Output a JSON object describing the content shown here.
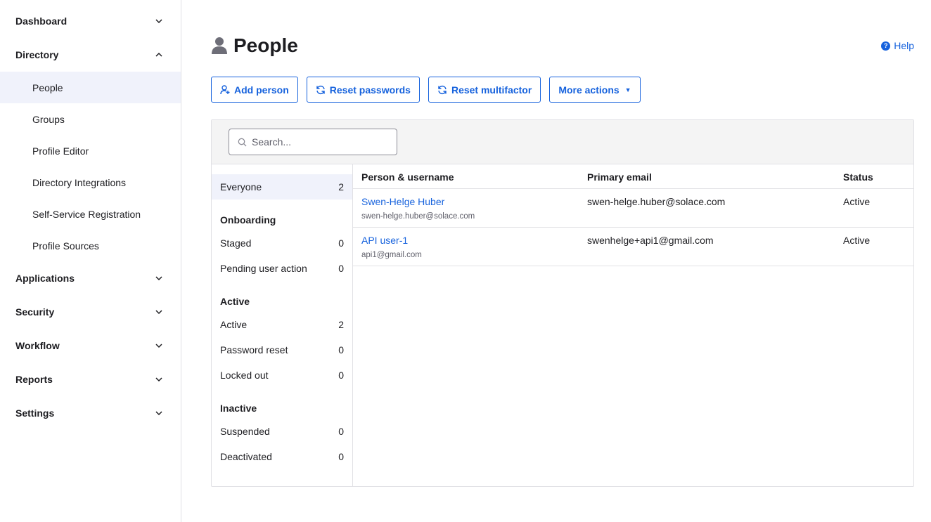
{
  "sidebar": {
    "groups": [
      {
        "label": "Dashboard",
        "expanded": false
      },
      {
        "label": "Directory",
        "expanded": true
      },
      {
        "label": "Applications",
        "expanded": false
      },
      {
        "label": "Security",
        "expanded": false
      },
      {
        "label": "Workflow",
        "expanded": false
      },
      {
        "label": "Reports",
        "expanded": false
      },
      {
        "label": "Settings",
        "expanded": false
      }
    ],
    "directory_items": [
      {
        "label": "People",
        "active": true
      },
      {
        "label": "Groups"
      },
      {
        "label": "Profile Editor"
      },
      {
        "label": "Directory Integrations"
      },
      {
        "label": "Self-Service Registration"
      },
      {
        "label": "Profile Sources"
      }
    ]
  },
  "header": {
    "title": "People",
    "help_label": "Help"
  },
  "toolbar": {
    "add_person": "Add person",
    "reset_passwords": "Reset passwords",
    "reset_multifactor": "Reset multifactor",
    "more_actions": "More actions"
  },
  "search": {
    "placeholder": "Search..."
  },
  "filters": {
    "everyone": {
      "label": "Everyone",
      "count": "2"
    },
    "sections": [
      {
        "heading": "Onboarding",
        "items": [
          {
            "label": "Staged",
            "count": "0"
          },
          {
            "label": "Pending user action",
            "count": "0"
          }
        ]
      },
      {
        "heading": "Active",
        "items": [
          {
            "label": "Active",
            "count": "2"
          },
          {
            "label": "Password reset",
            "count": "0"
          },
          {
            "label": "Locked out",
            "count": "0"
          }
        ]
      },
      {
        "heading": "Inactive",
        "items": [
          {
            "label": "Suspended",
            "count": "0"
          },
          {
            "label": "Deactivated",
            "count": "0"
          }
        ]
      }
    ]
  },
  "table": {
    "columns": [
      "Person & username",
      "Primary email",
      "Status"
    ],
    "rows": [
      {
        "name": "Swen-Helge Huber",
        "username": "swen-helge.huber@solace.com",
        "email": "swen-helge.huber@solace.com",
        "status": "Active"
      },
      {
        "name": "API user-1",
        "username": "api1@gmail.com",
        "email": "swenhelge+api1@gmail.com",
        "status": "Active"
      }
    ]
  },
  "colors": {
    "accent": "#1662dd",
    "selected_bg": "#f0f2fb",
    "panel_header_bg": "#f4f4f4"
  }
}
